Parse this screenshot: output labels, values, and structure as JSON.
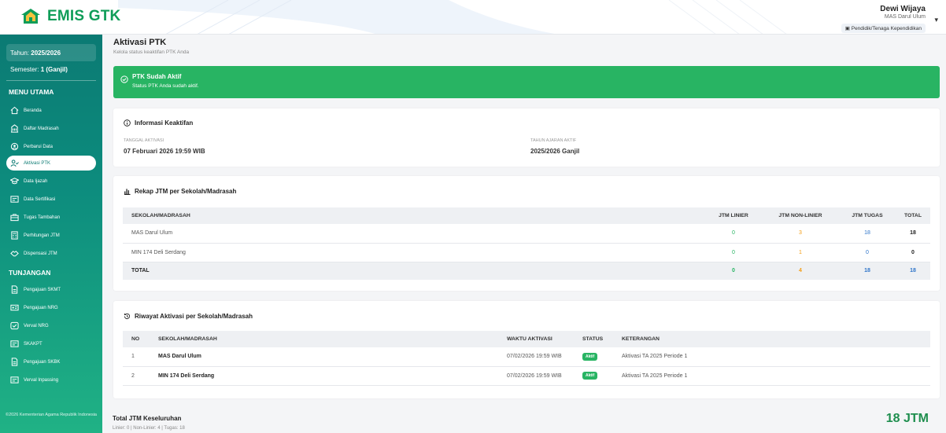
{
  "header": {
    "app_name": "EMIS GTK",
    "user_name": "Dewi Wijaya",
    "user_institution": "MAS Darul Ulum",
    "user_role": "Pendidik/Tenaga Kependidikan"
  },
  "sidebar": {
    "year_label": "Tahun:",
    "year_value": "2025/2026",
    "semester_label": "Semester:",
    "semester_value": "1 (Ganjil)",
    "main_menu_title": "MENU UTAMA",
    "items": [
      {
        "label": "Beranda",
        "icon": "home-icon"
      },
      {
        "label": "Daftar Madrasah",
        "icon": "building-icon"
      },
      {
        "label": "Perbarui Data",
        "icon": "user-gear-icon"
      },
      {
        "label": "Aktivasi PTK",
        "icon": "user-check-icon"
      },
      {
        "label": "Data Ijazah",
        "icon": "graduation-cap-icon"
      },
      {
        "label": "Data Sertifikasi",
        "icon": "certificate-icon"
      },
      {
        "label": "Tugas Tambahan",
        "icon": "briefcase-icon"
      },
      {
        "label": "Perhitungan JTM",
        "icon": "calculator-icon"
      },
      {
        "label": "Dispensasi JTM",
        "icon": "handshake-icon"
      }
    ],
    "tunjangan_title": "TUNJANGAN",
    "tunjangan_items": [
      {
        "label": "Pengajuan SKMT",
        "icon": "document-icon"
      },
      {
        "label": "Pengajuan NRG",
        "icon": "id-card-icon"
      },
      {
        "label": "Verval NRG",
        "icon": "check-square-icon"
      },
      {
        "label": "SKAKPT",
        "icon": "certificate-icon"
      },
      {
        "label": "Pengajuan SKBK",
        "icon": "document-icon"
      },
      {
        "label": "Verval Inpassing",
        "icon": "certificate-icon"
      }
    ],
    "footer": "©2026 Kementerian Agama Republik Indonesia"
  },
  "page": {
    "title": "Aktivasi PTK",
    "subtitle": "Kelola status keaktifan PTK Anda"
  },
  "alert": {
    "title": "PTK Sudah Aktif",
    "desc": "Status PTK Anda sudah aktif."
  },
  "info": {
    "title": "Informasi Keaktifan",
    "activation_label": "TANGGAL AKTIVASI",
    "activation_value": "07 Februari 2026 19:59 WIB",
    "year_label": "TAHUN AJARAN AKTIF",
    "year_value": "2025/2026 Ganjil"
  },
  "rekap": {
    "title": "Rekap JTM per Sekolah/Madrasah",
    "headers": [
      "SEKOLAH/MADRASAH",
      "JTM LINIER",
      "JTM NON-LINIER",
      "JTM TUGAS",
      "TOTAL"
    ],
    "rows": [
      {
        "school": "MAS Darul Ulum",
        "linier": "0",
        "non_linier": "3",
        "tugas": "18",
        "total": "18"
      },
      {
        "school": "MIN 174 Deli Serdang",
        "linier": "0",
        "non_linier": "1",
        "tugas": "0",
        "total": "0"
      }
    ],
    "total": {
      "label": "TOTAL",
      "linier": "0",
      "non_linier": "4",
      "tugas": "18",
      "total": "18"
    }
  },
  "riwayat": {
    "title": "Riwayat Aktivasi per Sekolah/Madrasah",
    "headers": [
      "NO",
      "SEKOLAH/MADRASAH",
      "WAKTU AKTIVASI",
      "STATUS",
      "KETERANGAN"
    ],
    "rows": [
      {
        "no": "1",
        "school": "MAS Darul Ulum",
        "time": "07/02/2026 19:59 WIB",
        "status": "Aktif",
        "note": "Aktivasi TA 2025 Periode 1"
      },
      {
        "no": "2",
        "school": "MIN 174 Deli Serdang",
        "time": "07/02/2026 19:59 WIB",
        "status": "Aktif",
        "note": "Aktivasi TA 2025 Periode 1"
      }
    ]
  },
  "summary": {
    "title": "Total JTM Keseluruhan",
    "subtitle": "Linier: 0 | Non-Linier: 4 | Tugas: 18",
    "value": "18 JTM"
  },
  "colors": {
    "brand": "#0f9d58",
    "sidebar": "#0b7a73",
    "success": "#28b463",
    "warning": "#f39c12",
    "info": "#2e74c9"
  }
}
